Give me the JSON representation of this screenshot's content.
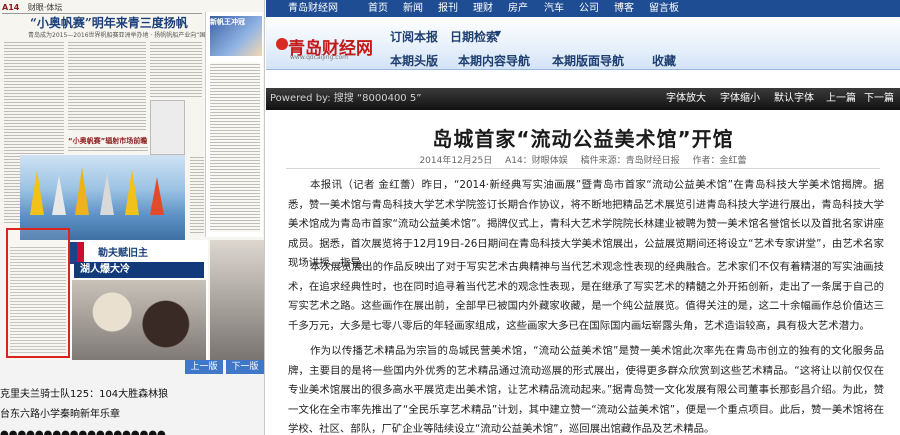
{
  "left_panel": {
    "newspaper": {
      "page_label": "A14",
      "section_label": "财眼·体坛",
      "main_title": "“小奥帆赛”明年来青三度扬帆",
      "main_subtitle": "青岛成为2015—2016世界帆船赛亚洲举办地 · 扬帆帆船产业向“国际化”",
      "section_feature_title": "“小奥帆赛”辐射市场前瞻",
      "sidebar_box_title": "新帆王冲冠",
      "nba_title": "勒夫赋旧主",
      "nba_title2": "湖人爆大冷"
    },
    "page_nav": {
      "prev_label": "上一版",
      "next_label": "下一版"
    },
    "headlines": [
      "克里夫兰骑士队125：104大胜森林狼",
      "台东六路小学秦晌新年乐章",
      "●●●●●●●●●●●●●●●●●●●"
    ]
  },
  "right_panel": {
    "topbar": {
      "site_name": "青岛财经网",
      "links": [
        "首页",
        "新闻",
        "报刊",
        "理财",
        "房产",
        "汽车",
        "公司",
        "博客",
        "留言板"
      ]
    },
    "brandbar": {
      "logo_text": "青岛财经网",
      "logo_url_text": "www.qdcaijing.com",
      "links": [
        {
          "label": "订阅本报"
        },
        {
          "label": "日期检索"
        },
        {
          "label": "本期头版"
        },
        {
          "label": "本期内容导航"
        },
        {
          "label": "本期版面导航"
        },
        {
          "label": "收藏"
        }
      ]
    },
    "toolbar": {
      "keyword_text": "Powered by: 搜搜 “8000400 5”",
      "tools": [
        "字体放大",
        "字体缩小",
        "默认字体",
        "上一篇",
        "下一篇"
      ]
    },
    "article": {
      "title": "岛城首家“流动公益美术馆”开馆",
      "date": "2014年12月25日",
      "page": "A14：财眼体娱",
      "source": "稿件来源：青岛财经日报",
      "author": "作者：金红蕾",
      "paragraphs": [
        "本报讯（记者 金红蕾）昨日，“2014·新经典写实油画展”暨青岛市首家“流动公益美术馆”在青岛科技大学美术馆揭牌。据悉，赞一美术馆与青岛科技大学艺术学院签订长期合作协议，将不断地把精品艺术展览引进青岛科技大学进行展出，青岛科技大学美术馆成为青岛市首家“流动公益美术馆”。揭牌仪式上，青科大艺术学院院长林建业被聘为赞一美术馆名誉馆长以及首批名家讲座成员。据悉，首次展览将于12月19日-26日期间在青岛科技大学美术馆展出，公益展览期间还将设立“艺术专家讲堂”，由艺术名家现场讲授、指导。",
        "本次展览展出的作品反映出了对于写实艺术古典精神与当代艺术观念性表现的经典融合。艺术家们不仅有着精湛的写实油画技术，在追求经典性时，也在同时追寻着当代艺术的观念性表现，是在继承了写实艺术的精髓之外开拓创新，走出了一条属于自己的写实艺术之路。这些画作在展出前，全部早已被国内外藏家收藏，是一个纯公益展览。值得关注的是，这二十余幅画作总价值达三千多万元，大多是七零八零后的年轻画家组成，这些画家大多已在国际国内画坛崭露头角，艺术造诣较高，具有极大艺术潜力。",
        "作为以传播艺术精品为宗旨的岛城民营美术馆，“流动公益美术馆”是赞一美术馆此次率先在青岛市创立的独有的文化服务品牌，主要目的是将一些国内外优秀的艺术精品通过流动巡展的形式展出，使得更多群众欣赏到这些艺术精品。“这将让以前仅仅在专业美术馆展出的很多高水平展览走出美术馆，让艺术精品流动起来。”据青岛赞一文化发展有限公司董事长那彭昌介绍。为此，赞一文化在全市率先推出了“全民乐享艺术精品”计划，其中建立赞一“流动公益美术馆”，便是一个重点项目。此后，赞一美术馆将在学校、社区、部队，厂矿企业等陆续设立“流动公益美术馆”，巡回展出馆藏作品及艺术精品。"
      ]
    }
  }
}
